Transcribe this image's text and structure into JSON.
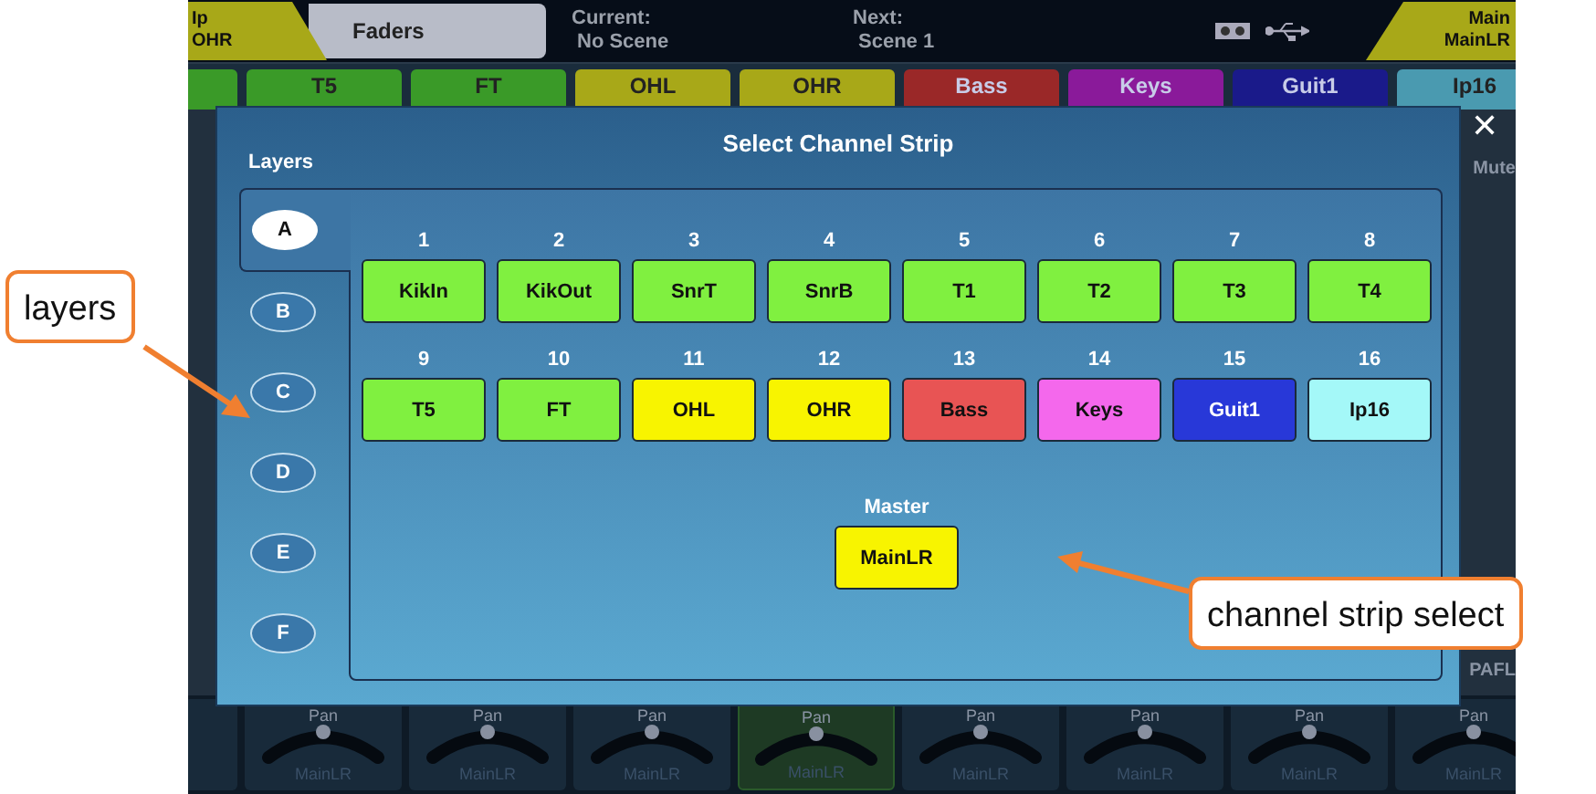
{
  "top_bar": {
    "scene_box": {
      "line1": "Ip",
      "line2": "OHR"
    },
    "tab": {
      "label": "Faders",
      "selected": true
    },
    "current": {
      "label": "Current:",
      "value": "No Scene"
    },
    "next": {
      "label": "Next:",
      "value": "Scene 1"
    },
    "main_box": {
      "line1": "Main",
      "line2": "MainLR"
    }
  },
  "strips": [
    {
      "color": "#3a9a28"
    },
    {
      "name": "T5",
      "color": "#3a9a28"
    },
    {
      "name": "FT",
      "color": "#3a9a28"
    },
    {
      "name": "OHL",
      "color": "#a8a818"
    },
    {
      "name": "OHR",
      "color": "#a8a818"
    },
    {
      "name": "Bass",
      "color": "#9a2828"
    },
    {
      "name": "Keys",
      "color": "#8a1a9a"
    },
    {
      "name": "Guit1",
      "color": "#1a1a8a"
    },
    {
      "name": "Ip16",
      "color": "#4a9ab0"
    }
  ],
  "side_labels": [
    "Mute",
    "PAFL"
  ],
  "pans": [
    {
      "label": "Pan",
      "bus": "MainLR",
      "selected": false
    },
    {
      "label": "Pan",
      "bus": "MainLR",
      "selected": false
    },
    {
      "label": "Pan",
      "bus": "MainLR",
      "selected": false
    },
    {
      "label": "Pan",
      "bus": "MainLR",
      "selected": true
    },
    {
      "label": "Pan",
      "bus": "MainLR",
      "selected": false
    },
    {
      "label": "Pan",
      "bus": "MainLR",
      "selected": false
    },
    {
      "label": "Pan",
      "bus": "MainLR",
      "selected": false
    },
    {
      "label": "Pan",
      "bus": "MainLR",
      "selected": false
    }
  ],
  "dialog": {
    "title": "Select Channel Strip",
    "close": "✕",
    "layers_label": "Layers",
    "layers": [
      {
        "label": "A",
        "selected": true
      },
      {
        "label": "B",
        "selected": false
      },
      {
        "label": "C",
        "selected": false
      },
      {
        "label": "D",
        "selected": false
      },
      {
        "label": "E",
        "selected": false
      },
      {
        "label": "F",
        "selected": false
      }
    ],
    "channels": [
      {
        "number": "1",
        "name": "KikIn",
        "color": "#80f040"
      },
      {
        "number": "2",
        "name": "KikOut",
        "color": "#80f040"
      },
      {
        "number": "3",
        "name": "SnrT",
        "color": "#80f040"
      },
      {
        "number": "4",
        "name": "SnrB",
        "color": "#80f040"
      },
      {
        "number": "5",
        "name": "T1",
        "color": "#80f040"
      },
      {
        "number": "6",
        "name": "T2",
        "color": "#80f040"
      },
      {
        "number": "7",
        "name": "T3",
        "color": "#80f040"
      },
      {
        "number": "8",
        "name": "T4",
        "color": "#80f040"
      },
      {
        "number": "9",
        "name": "T5",
        "color": "#80f040"
      },
      {
        "number": "10",
        "name": "FT",
        "color": "#80f040"
      },
      {
        "number": "11",
        "name": "OHL",
        "color": "#f8f400"
      },
      {
        "number": "12",
        "name": "OHR",
        "color": "#f8f400"
      },
      {
        "number": "13",
        "name": "Bass",
        "color": "#e85454"
      },
      {
        "number": "14",
        "name": "Keys",
        "color": "#f468ec"
      },
      {
        "number": "15",
        "name": "Guit1",
        "color": "#2838d8"
      },
      {
        "number": "16",
        "name": "Ip16",
        "color": "#a4f8f8"
      }
    ],
    "master": {
      "label": "Master",
      "name": "MainLR",
      "color": "#f8f400"
    }
  },
  "callouts": [
    {
      "text": "layers"
    },
    {
      "text": "channel strip select"
    }
  ]
}
